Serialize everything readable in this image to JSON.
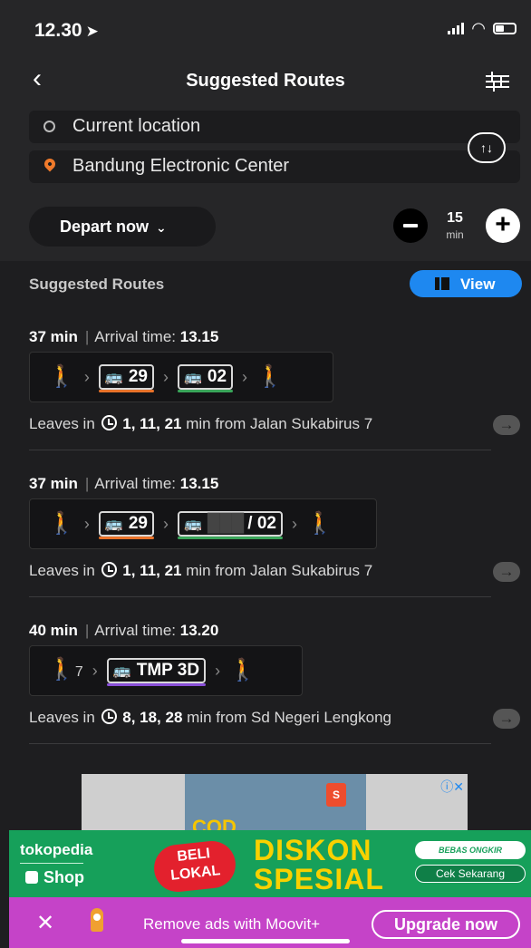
{
  "status_bar": {
    "time": "12.30",
    "location_arrow": "➤",
    "wifi_icon": "wifi-icon",
    "battery_icon": "battery-icon"
  },
  "nav": {
    "back_icon": "‹",
    "title": "Suggested Routes",
    "filter_icon": "sliders-icon"
  },
  "locations": {
    "from": "Current location",
    "to": "Bandung Electronic Center",
    "swap_label": "↑↓"
  },
  "depart": {
    "label": "Depart now",
    "chevron": "⌄"
  },
  "stepper": {
    "minus": "−",
    "value": "15",
    "unit": "min",
    "plus": "+"
  },
  "suggested": {
    "title": "Suggested Routes",
    "view_label": "View"
  },
  "colors": {
    "accent": "#1e88f0",
    "line_orange": "#e8722a",
    "line_green": "#3aa55a",
    "line_purple": "#8a50d8"
  },
  "routes": [
    {
      "duration": "37 min",
      "arrival_label": "Arrival time:",
      "arrival": "13.15",
      "bus1": "29",
      "bus2": "02",
      "leaves_prefix": "Leaves in",
      "leaves_times": "1, 11, 21",
      "leaves_suffix": "min from Jalan Sukabirus 7"
    },
    {
      "duration": "37 min",
      "arrival_label": "Arrival time:",
      "arrival": "13.15",
      "bus1": "29",
      "bus2": "/ 02",
      "leaves_prefix": "Leaves in",
      "leaves_times": "1, 11, 21",
      "leaves_suffix": "min from Jalan Sukabirus 7"
    },
    {
      "duration": "40 min",
      "arrival_label": "Arrival time:",
      "arrival": "13.20",
      "walk_minutes": "7",
      "bus1": "TMP 3D",
      "leaves_prefix": "Leaves in",
      "leaves_times": "8, 18, 28",
      "leaves_suffix": "min from Sd Negeri Lengkong"
    }
  ],
  "ad": {
    "caption": "COD",
    "shopee_label": "S",
    "info_icon": "ⓘ✕",
    "brand": "tokopedia",
    "shop": "Shop",
    "badge": "BELI LOKAL",
    "headline_1": "DISKON",
    "headline_2": "SPESIAL",
    "free_shipping": "BEBAS ONGKIR",
    "cta": "Cek Sekarang"
  },
  "moovit": {
    "close": "✕",
    "message": "Remove ads with Moovit+",
    "upgrade": "Upgrade now"
  }
}
